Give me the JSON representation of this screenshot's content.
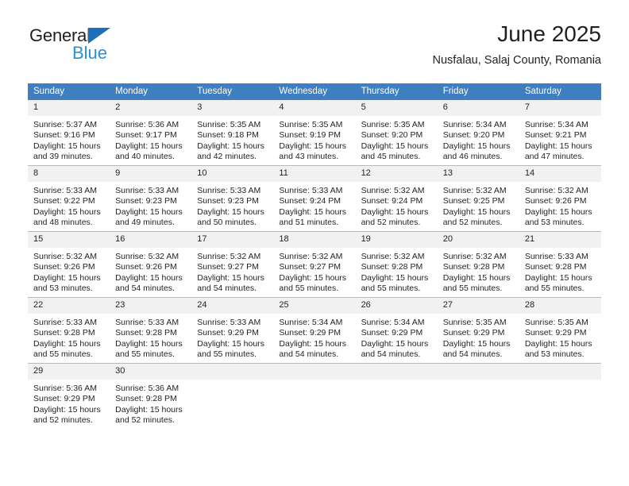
{
  "logo": {
    "word_top": "General",
    "word_bottom": "Blue",
    "triangle_color": "#1e6fb8",
    "blue_text_color": "#2a8fd4"
  },
  "header": {
    "title": "June 2025",
    "subtitle": "Nusfalau, Salaj County, Romania"
  },
  "colors": {
    "header_row_bg": "#3f7fc1",
    "header_row_text": "#ffffff",
    "daynum_bg": "#f1f1f1",
    "grid_line": "#b9b9b9",
    "body_text": "#231f20"
  },
  "weekdays": [
    "Sunday",
    "Monday",
    "Tuesday",
    "Wednesday",
    "Thursday",
    "Friday",
    "Saturday"
  ],
  "weeks": [
    [
      {
        "day": "1",
        "sunrise": "Sunrise: 5:37 AM",
        "sunset": "Sunset: 9:16 PM",
        "daylight1": "Daylight: 15 hours",
        "daylight2": "and 39 minutes."
      },
      {
        "day": "2",
        "sunrise": "Sunrise: 5:36 AM",
        "sunset": "Sunset: 9:17 PM",
        "daylight1": "Daylight: 15 hours",
        "daylight2": "and 40 minutes."
      },
      {
        "day": "3",
        "sunrise": "Sunrise: 5:35 AM",
        "sunset": "Sunset: 9:18 PM",
        "daylight1": "Daylight: 15 hours",
        "daylight2": "and 42 minutes."
      },
      {
        "day": "4",
        "sunrise": "Sunrise: 5:35 AM",
        "sunset": "Sunset: 9:19 PM",
        "daylight1": "Daylight: 15 hours",
        "daylight2": "and 43 minutes."
      },
      {
        "day": "5",
        "sunrise": "Sunrise: 5:35 AM",
        "sunset": "Sunset: 9:20 PM",
        "daylight1": "Daylight: 15 hours",
        "daylight2": "and 45 minutes."
      },
      {
        "day": "6",
        "sunrise": "Sunrise: 5:34 AM",
        "sunset": "Sunset: 9:20 PM",
        "daylight1": "Daylight: 15 hours",
        "daylight2": "and 46 minutes."
      },
      {
        "day": "7",
        "sunrise": "Sunrise: 5:34 AM",
        "sunset": "Sunset: 9:21 PM",
        "daylight1": "Daylight: 15 hours",
        "daylight2": "and 47 minutes."
      }
    ],
    [
      {
        "day": "8",
        "sunrise": "Sunrise: 5:33 AM",
        "sunset": "Sunset: 9:22 PM",
        "daylight1": "Daylight: 15 hours",
        "daylight2": "and 48 minutes."
      },
      {
        "day": "9",
        "sunrise": "Sunrise: 5:33 AM",
        "sunset": "Sunset: 9:23 PM",
        "daylight1": "Daylight: 15 hours",
        "daylight2": "and 49 minutes."
      },
      {
        "day": "10",
        "sunrise": "Sunrise: 5:33 AM",
        "sunset": "Sunset: 9:23 PM",
        "daylight1": "Daylight: 15 hours",
        "daylight2": "and 50 minutes."
      },
      {
        "day": "11",
        "sunrise": "Sunrise: 5:33 AM",
        "sunset": "Sunset: 9:24 PM",
        "daylight1": "Daylight: 15 hours",
        "daylight2": "and 51 minutes."
      },
      {
        "day": "12",
        "sunrise": "Sunrise: 5:32 AM",
        "sunset": "Sunset: 9:24 PM",
        "daylight1": "Daylight: 15 hours",
        "daylight2": "and 52 minutes."
      },
      {
        "day": "13",
        "sunrise": "Sunrise: 5:32 AM",
        "sunset": "Sunset: 9:25 PM",
        "daylight1": "Daylight: 15 hours",
        "daylight2": "and 52 minutes."
      },
      {
        "day": "14",
        "sunrise": "Sunrise: 5:32 AM",
        "sunset": "Sunset: 9:26 PM",
        "daylight1": "Daylight: 15 hours",
        "daylight2": "and 53 minutes."
      }
    ],
    [
      {
        "day": "15",
        "sunrise": "Sunrise: 5:32 AM",
        "sunset": "Sunset: 9:26 PM",
        "daylight1": "Daylight: 15 hours",
        "daylight2": "and 53 minutes."
      },
      {
        "day": "16",
        "sunrise": "Sunrise: 5:32 AM",
        "sunset": "Sunset: 9:26 PM",
        "daylight1": "Daylight: 15 hours",
        "daylight2": "and 54 minutes."
      },
      {
        "day": "17",
        "sunrise": "Sunrise: 5:32 AM",
        "sunset": "Sunset: 9:27 PM",
        "daylight1": "Daylight: 15 hours",
        "daylight2": "and 54 minutes."
      },
      {
        "day": "18",
        "sunrise": "Sunrise: 5:32 AM",
        "sunset": "Sunset: 9:27 PM",
        "daylight1": "Daylight: 15 hours",
        "daylight2": "and 55 minutes."
      },
      {
        "day": "19",
        "sunrise": "Sunrise: 5:32 AM",
        "sunset": "Sunset: 9:28 PM",
        "daylight1": "Daylight: 15 hours",
        "daylight2": "and 55 minutes."
      },
      {
        "day": "20",
        "sunrise": "Sunrise: 5:32 AM",
        "sunset": "Sunset: 9:28 PM",
        "daylight1": "Daylight: 15 hours",
        "daylight2": "and 55 minutes."
      },
      {
        "day": "21",
        "sunrise": "Sunrise: 5:33 AM",
        "sunset": "Sunset: 9:28 PM",
        "daylight1": "Daylight: 15 hours",
        "daylight2": "and 55 minutes."
      }
    ],
    [
      {
        "day": "22",
        "sunrise": "Sunrise: 5:33 AM",
        "sunset": "Sunset: 9:28 PM",
        "daylight1": "Daylight: 15 hours",
        "daylight2": "and 55 minutes."
      },
      {
        "day": "23",
        "sunrise": "Sunrise: 5:33 AM",
        "sunset": "Sunset: 9:28 PM",
        "daylight1": "Daylight: 15 hours",
        "daylight2": "and 55 minutes."
      },
      {
        "day": "24",
        "sunrise": "Sunrise: 5:33 AM",
        "sunset": "Sunset: 9:29 PM",
        "daylight1": "Daylight: 15 hours",
        "daylight2": "and 55 minutes."
      },
      {
        "day": "25",
        "sunrise": "Sunrise: 5:34 AM",
        "sunset": "Sunset: 9:29 PM",
        "daylight1": "Daylight: 15 hours",
        "daylight2": "and 54 minutes."
      },
      {
        "day": "26",
        "sunrise": "Sunrise: 5:34 AM",
        "sunset": "Sunset: 9:29 PM",
        "daylight1": "Daylight: 15 hours",
        "daylight2": "and 54 minutes."
      },
      {
        "day": "27",
        "sunrise": "Sunrise: 5:35 AM",
        "sunset": "Sunset: 9:29 PM",
        "daylight1": "Daylight: 15 hours",
        "daylight2": "and 54 minutes."
      },
      {
        "day": "28",
        "sunrise": "Sunrise: 5:35 AM",
        "sunset": "Sunset: 9:29 PM",
        "daylight1": "Daylight: 15 hours",
        "daylight2": "and 53 minutes."
      }
    ],
    [
      {
        "day": "29",
        "sunrise": "Sunrise: 5:36 AM",
        "sunset": "Sunset: 9:29 PM",
        "daylight1": "Daylight: 15 hours",
        "daylight2": "and 52 minutes."
      },
      {
        "day": "30",
        "sunrise": "Sunrise: 5:36 AM",
        "sunset": "Sunset: 9:28 PM",
        "daylight1": "Daylight: 15 hours",
        "daylight2": "and 52 minutes."
      },
      {
        "day": "",
        "sunrise": "",
        "sunset": "",
        "daylight1": "",
        "daylight2": "",
        "empty": true
      },
      {
        "day": "",
        "sunrise": "",
        "sunset": "",
        "daylight1": "",
        "daylight2": "",
        "empty": true
      },
      {
        "day": "",
        "sunrise": "",
        "sunset": "",
        "daylight1": "",
        "daylight2": "",
        "empty": true
      },
      {
        "day": "",
        "sunrise": "",
        "sunset": "",
        "daylight1": "",
        "daylight2": "",
        "empty": true
      },
      {
        "day": "",
        "sunrise": "",
        "sunset": "",
        "daylight1": "",
        "daylight2": "",
        "empty": true
      }
    ]
  ]
}
